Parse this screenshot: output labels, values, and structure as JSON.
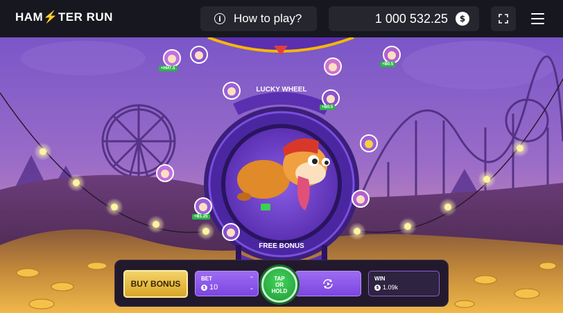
{
  "header": {
    "logo_text_1": "HAM",
    "logo_text_2": "TER RUN",
    "how_to_play": "How to play?",
    "balance": "1 000 532.25",
    "currency_symbol": "$",
    "info_icon": "info-icon",
    "fullscreen_icon": "fullscreen-icon",
    "menu_icon": "hamburger-menu-icon"
  },
  "wheel": {
    "top_label": "LUCKY WHEEL",
    "bottom_label": "FREE BONUS",
    "character": "hamster-runner"
  },
  "badges": [
    "+НИ7.5",
    "+В0.5",
    "+В0.5",
    "+В1.25"
  ],
  "controls": {
    "buy_bonus": "BUY BONUS",
    "bet_label": "BET",
    "bet_value": "10",
    "tap_line1": "TAP",
    "tap_line2": "OR",
    "tap_line3": "HOLD",
    "autoplay_icon": "autoplay-icon",
    "win_label": "WIN",
    "win_value": "1.09k"
  },
  "colors": {
    "accent_purple": "#7b46e0",
    "tap_green": "#2db34a",
    "buy_gold": "#d8a628"
  }
}
